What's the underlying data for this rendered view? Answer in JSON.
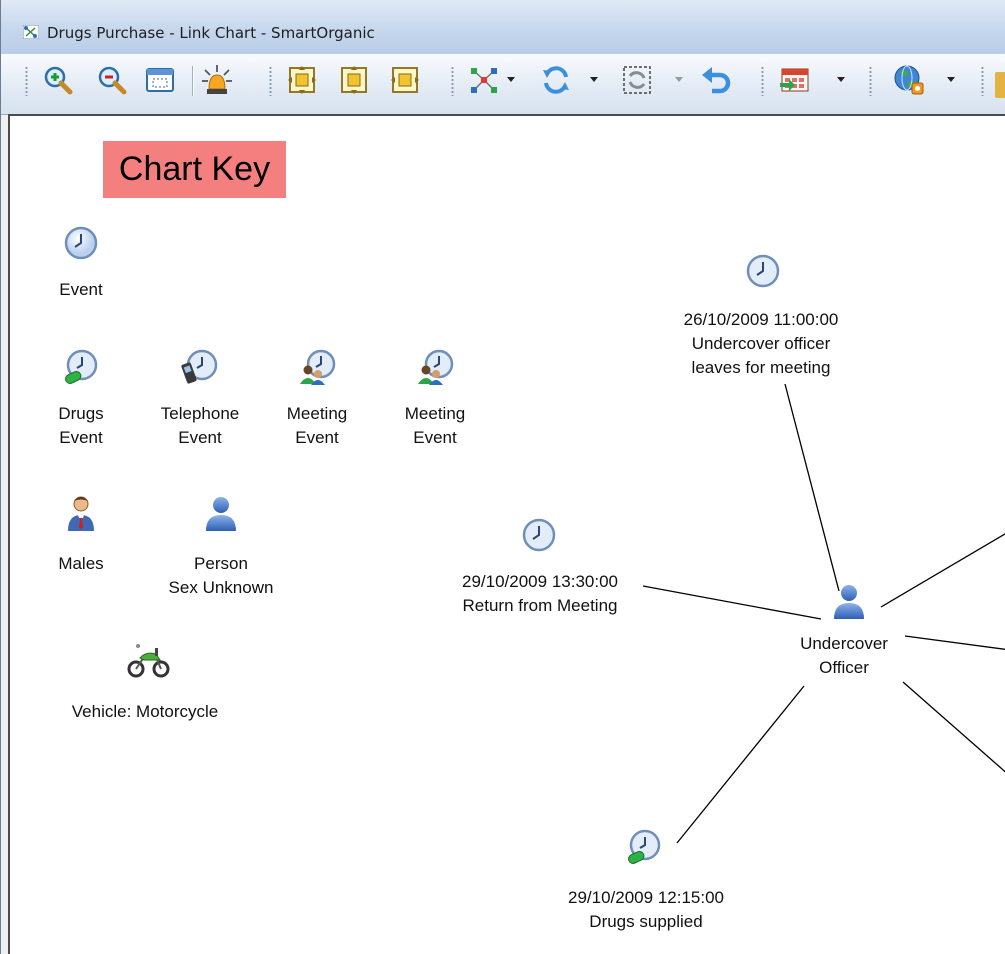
{
  "window": {
    "title": "Drugs Purchase - Link Chart - SmartOrganic"
  },
  "toolbar": {
    "buttons": [
      "zoom-in-icon",
      "zoom-out-icon",
      "window-view-icon",
      "alert-light-icon",
      "fit-all-icon",
      "fit-vertical-icon",
      "fit-horizontal-icon",
      "network-layout-icon",
      "refresh-icon",
      "refresh-selection-icon",
      "undo-icon",
      "calendar-icon",
      "globe-map-icon"
    ]
  },
  "chart_key": {
    "title": "Chart Key",
    "event_label": "Event",
    "drugs_event_label": [
      "Drugs",
      "Event"
    ],
    "telephone_event_label": [
      "Telephone",
      "Event"
    ],
    "meeting_event_1_label": [
      "Meeting",
      "Event"
    ],
    "meeting_event_2_label": [
      "Meeting",
      "Event"
    ],
    "males_label": "Males",
    "person_label": [
      "Person",
      "Sex Unknown"
    ],
    "vehicle_label": "Vehicle: Motorcycle"
  },
  "nodes": {
    "leaves_meeting": [
      "26/10/2009 11:00:00",
      "Undercover officer",
      "leaves for meeting"
    ],
    "return_meeting": [
      "29/10/2009 13:30:00",
      "Return from Meeting"
    ],
    "undercover_officer": [
      "Undercover",
      "Officer"
    ],
    "drugs_supplied": [
      "29/10/2009 12:15:00",
      "Drugs supplied"
    ]
  },
  "colors": {
    "chart_key_bg": "#f47f7f",
    "title_bar": "#c4d6ec",
    "person_blue": "#3d6fc4",
    "clock_face": "#d9e6f7"
  }
}
